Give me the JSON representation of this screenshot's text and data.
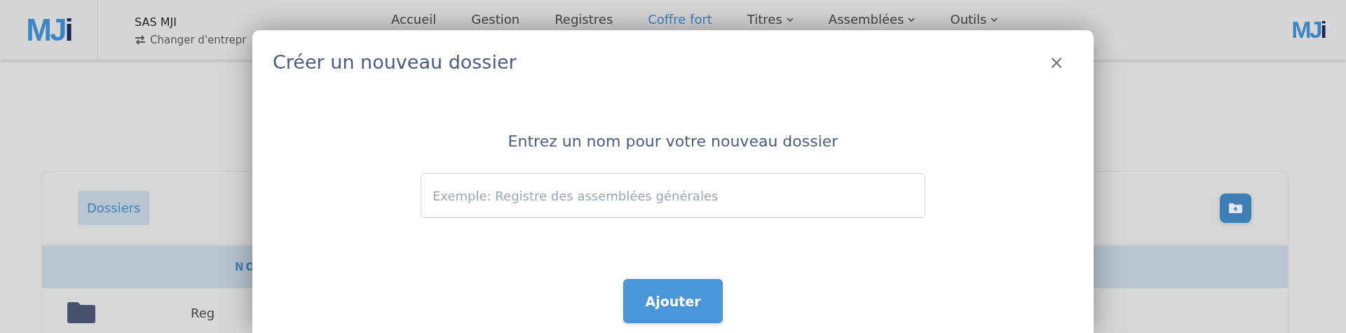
{
  "navbar": {
    "logo": "MJi",
    "company": "SAS MJI",
    "switch_label": "Changer d'entrepr",
    "items": [
      {
        "label": "Accueil",
        "selected": false,
        "dropdown": false
      },
      {
        "label": "Gestion",
        "selected": false,
        "dropdown": false
      },
      {
        "label": "Registres",
        "selected": false,
        "dropdown": false
      },
      {
        "label": "Coffre fort",
        "selected": true,
        "dropdown": false
      },
      {
        "label": "Titres",
        "selected": false,
        "dropdown": true
      },
      {
        "label": "Assemblées",
        "selected": false,
        "dropdown": true
      },
      {
        "label": "Outils",
        "selected": false,
        "dropdown": true
      }
    ],
    "right_logo": "MJi"
  },
  "card": {
    "tab": "Dossiers",
    "table": {
      "columns": [
        "NO"
      ],
      "rows": [
        {
          "name": "Reg"
        }
      ]
    }
  },
  "modal": {
    "title": "Créer un nouveau dossier",
    "close": "×",
    "prompt": "Entrez un nom pour votre nouveau dossier",
    "input": {
      "placeholder": "Exemple: Registre des assemblées générales"
    },
    "submit": "Ajouter"
  }
}
